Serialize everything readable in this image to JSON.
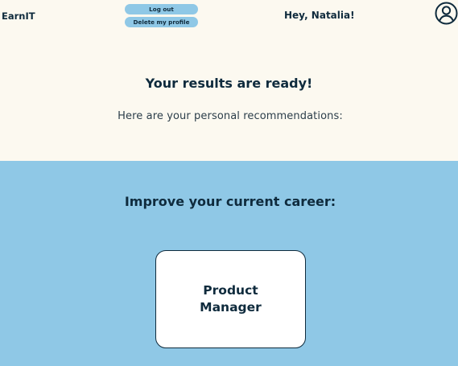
{
  "header": {
    "brand": "EarnIT",
    "logout_label": "Log out",
    "delete_profile_label": "Delete my profile",
    "greeting": "Hey, Natalia!",
    "profile_icon": "user-circle-icon"
  },
  "results": {
    "title": "Your results are ready!",
    "subtitle": "Here are your personal recommendations:"
  },
  "recommendations": {
    "section_title": "Improve your current career:",
    "cards": [
      {
        "label": "Product Manager"
      }
    ]
  },
  "colors": {
    "top_background": "#fcf9f0",
    "section_background": "#8fc8e6",
    "primary_text": "#0f2b3d",
    "card_background": "#ffffff"
  }
}
